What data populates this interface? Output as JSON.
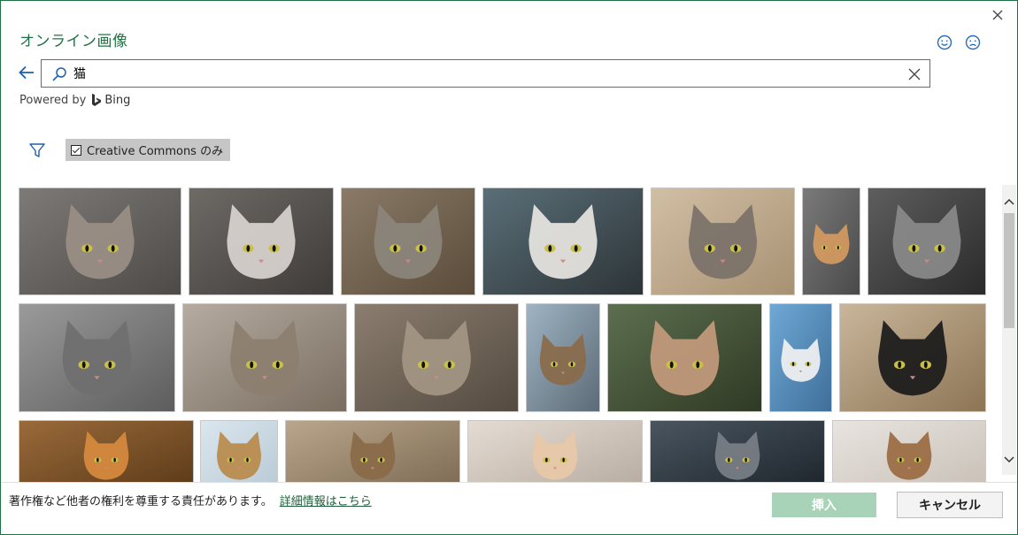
{
  "dialog": {
    "title": "オンライン画像",
    "powered_by": "Powered by",
    "bing_label": "Bing"
  },
  "search": {
    "value": "猫"
  },
  "filter": {
    "creative_commons_label": "Creative Commons のみ"
  },
  "footer": {
    "notice": "著作権など他者の権利を尊重する責任があります。",
    "link": "詳細情報はこちら",
    "insert_label": "挿入",
    "cancel_label": "キャンセル"
  },
  "icons": [
    "close-icon",
    "smiley-icon",
    "frown-icon",
    "back-arrow-icon",
    "search-icon",
    "clear-icon",
    "bing-logo-icon",
    "filter-icon",
    "checkbox-icon",
    "scroll-up-icon",
    "scroll-down-icon"
  ],
  "colors": {
    "accent": "#217346",
    "insert_disabled": "#a9d3b8",
    "chip_bg": "#c6c6c6"
  },
  "thumbnails": [
    {
      "tone": [
        "#7d7a77",
        "#4d4a47"
      ],
      "subject": "#9a8f86"
    },
    {
      "tone": [
        "#6e6a66",
        "#3f3b38"
      ],
      "subject": "#d9d4cf"
    },
    {
      "tone": [
        "#8a7a67",
        "#5b4b3a"
      ],
      "subject": "#8c857c"
    },
    {
      "tone": [
        "#5a6f78",
        "#2d3438"
      ],
      "subject": "#e8e6e2"
    },
    {
      "tone": [
        "#d1bfa4",
        "#a89173"
      ],
      "subject": "#7a7169"
    },
    {
      "tone": [
        "#7a7a7a",
        "#4a4a4a"
      ],
      "subject": "#d59a5f"
    },
    {
      "tone": [
        "#5e5e5e",
        "#2a2a2a"
      ],
      "subject": "#8a8a8a"
    },
    {
      "tone": [
        "#9a9a9a",
        "#5d5d5d"
      ],
      "subject": "#6f6f6f"
    },
    {
      "tone": [
        "#b5aba0",
        "#7a6e61"
      ],
      "subject": "#8c7f70"
    },
    {
      "tone": [
        "#8b7e6f",
        "#544a40"
      ],
      "subject": "#a49684"
    },
    {
      "tone": [
        "#9fb4c4",
        "#5c6b76"
      ],
      "subject": "#8a6a4a"
    },
    {
      "tone": [
        "#5d6f4f",
        "#2f3a24"
      ],
      "subject": "#c49a7c"
    },
    {
      "tone": [
        "#6fa8d6",
        "#3f6f99"
      ],
      "subject": "#f2f2f2"
    },
    {
      "tone": [
        "#c9b69a",
        "#8d7455"
      ],
      "subject": "#1a1a1a"
    },
    {
      "tone": [
        "#9a6a3a",
        "#5b3a18"
      ],
      "subject": "#d78b3e"
    },
    {
      "tone": [
        "#dbe6ee",
        "#b9cad6"
      ],
      "subject": "#b88a4a"
    },
    {
      "tone": [
        "#b9a68c",
        "#7d6a53"
      ],
      "subject": "#8a6a48"
    },
    {
      "tone": [
        "#e4dcd3",
        "#b7aba0"
      ],
      "subject": "#e8c9a8"
    },
    {
      "tone": [
        "#4a5560",
        "#1d242b"
      ],
      "subject": "#7a7f86"
    },
    {
      "tone": [
        "#e8e4e0",
        "#c9c0b7"
      ],
      "subject": "#9a6a40"
    }
  ]
}
